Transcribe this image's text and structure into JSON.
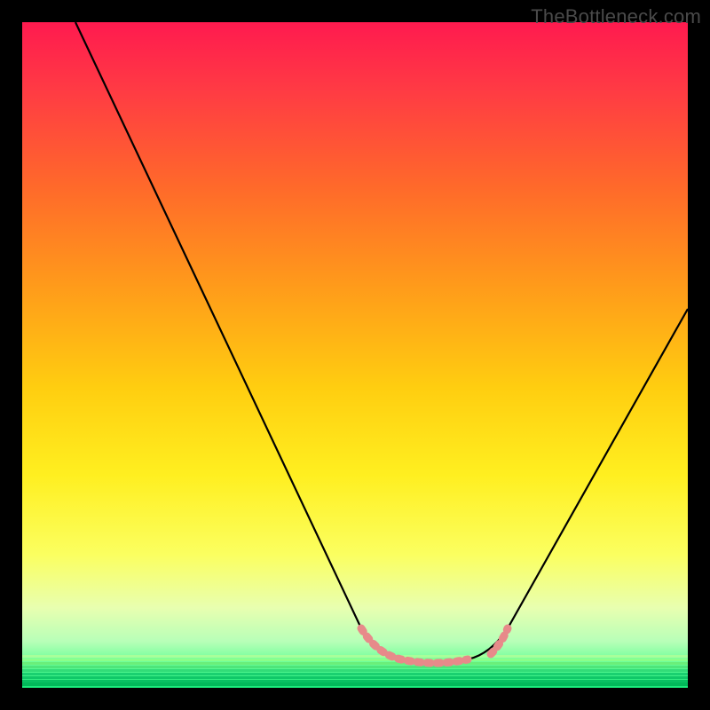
{
  "watermark": "TheBottleneck.com",
  "chart_data": {
    "type": "line",
    "title": "",
    "xlabel": "",
    "ylabel": "",
    "xlim": [
      0,
      100
    ],
    "ylim": [
      0,
      100
    ],
    "grid": false,
    "legend": false,
    "series": [
      {
        "name": "curve-black",
        "color": "#000000",
        "points": [
          {
            "x": 8,
            "y": 100
          },
          {
            "x": 51,
            "y": 9
          },
          {
            "x": 54,
            "y": 6
          },
          {
            "x": 57,
            "y": 5
          },
          {
            "x": 62,
            "y": 4
          },
          {
            "x": 67,
            "y": 5
          },
          {
            "x": 70,
            "y": 6
          },
          {
            "x": 73,
            "y": 9
          },
          {
            "x": 100,
            "y": 57
          }
        ]
      },
      {
        "name": "marker-pink-left",
        "color": "#e78a8a",
        "points": [
          {
            "x": 51,
            "y": 9
          },
          {
            "x": 54,
            "y": 6
          },
          {
            "x": 57,
            "y": 5
          },
          {
            "x": 62,
            "y": 4
          },
          {
            "x": 67,
            "y": 5
          }
        ]
      },
      {
        "name": "marker-pink-right",
        "color": "#e78a8a",
        "points": [
          {
            "x": 70,
            "y": 6
          },
          {
            "x": 73,
            "y": 9
          }
        ]
      }
    ],
    "annotations": [
      {
        "type": "text",
        "text": "TheBottleneck.com",
        "position": "top-right"
      }
    ]
  }
}
